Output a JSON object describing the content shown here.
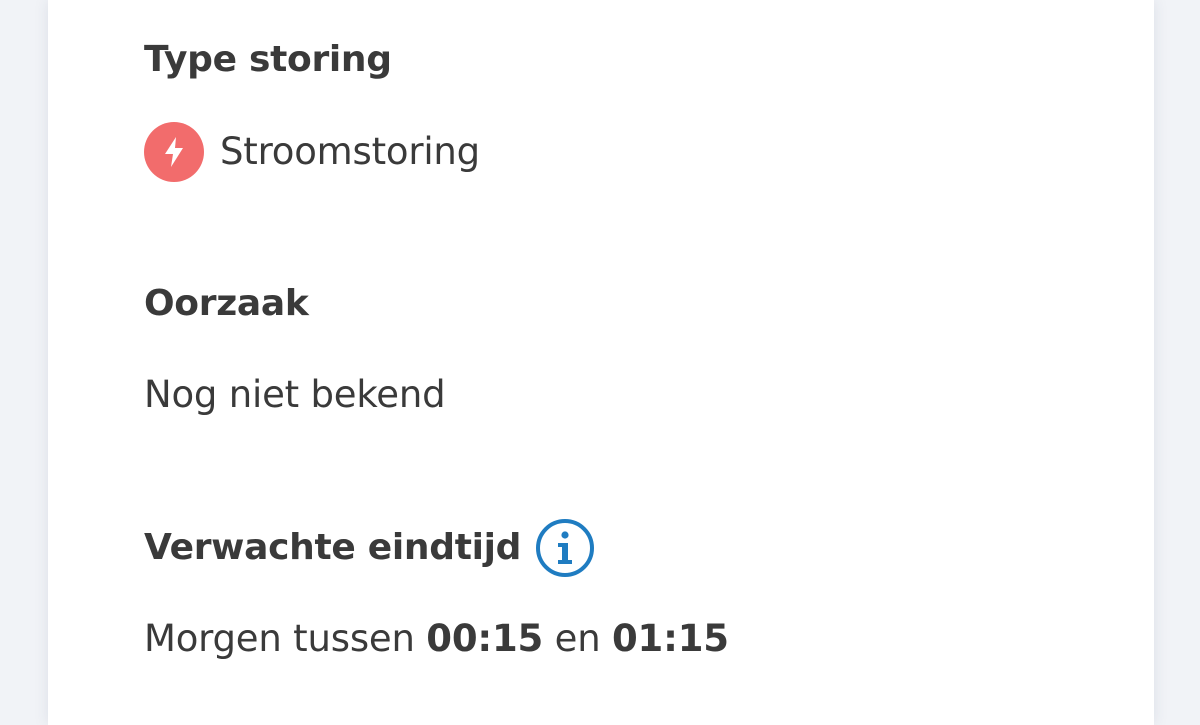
{
  "type_section": {
    "heading": "Type storing",
    "value": "Stroomstoring",
    "icon": "lightning-bolt-icon",
    "icon_color": "#f26c6c"
  },
  "cause_section": {
    "heading": "Oorzaak",
    "value": "Nog niet bekend"
  },
  "end_time_section": {
    "heading": "Verwachte eindtijd",
    "info_icon": "info-icon",
    "info_icon_color": "#1f7cc1",
    "prefix": "Morgen tussen",
    "start_time": "00:15",
    "connector": "en",
    "end_time": "01:15"
  }
}
